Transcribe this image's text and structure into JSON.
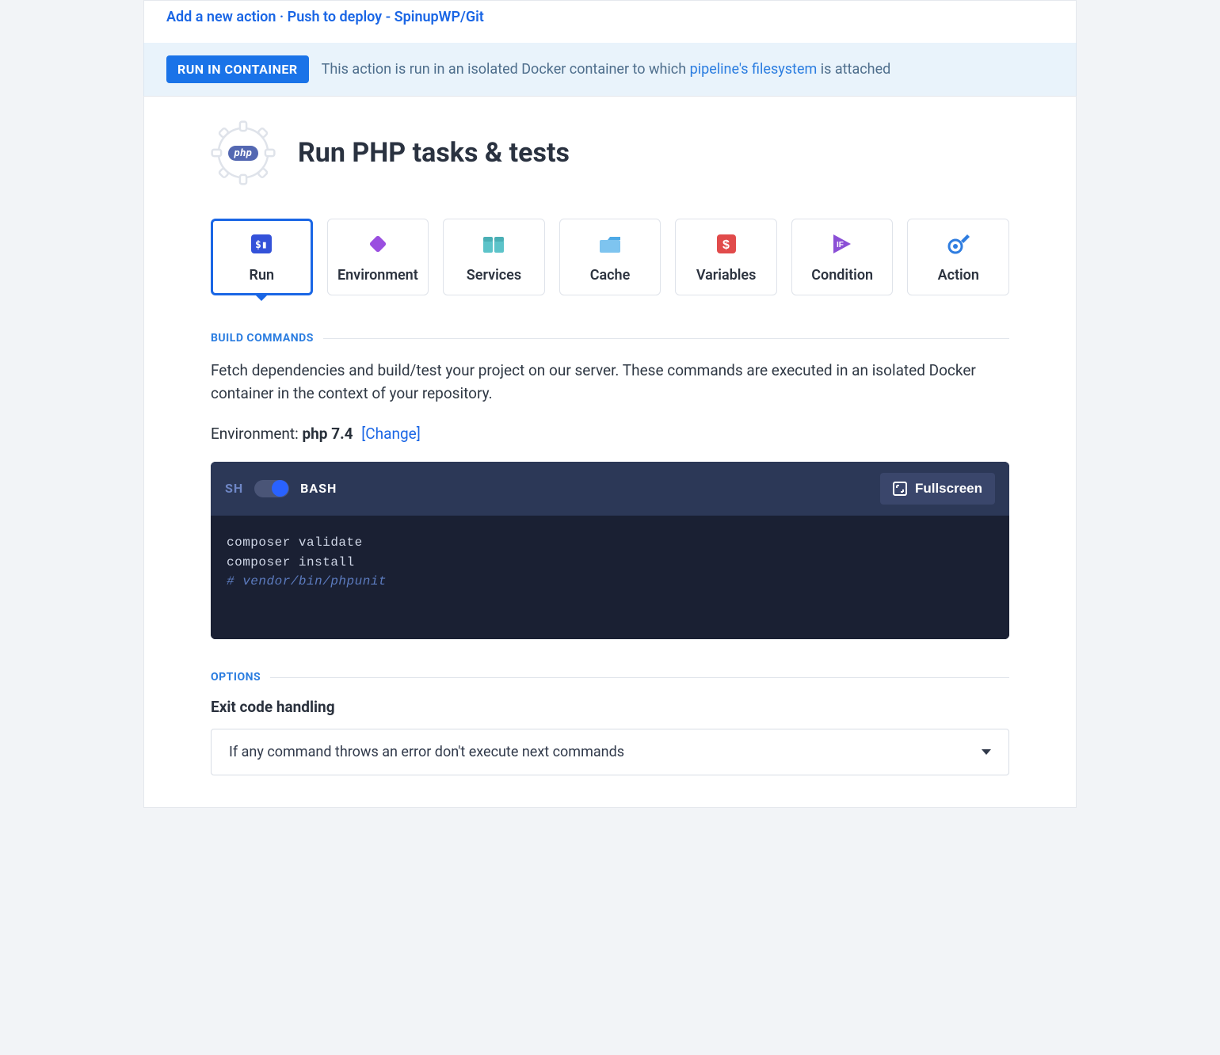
{
  "breadcrumb": {
    "a": "Add a new action",
    "b": "Push to deploy - SpinupWP/Git"
  },
  "infostrip": {
    "badge": "RUN IN CONTAINER",
    "text_a": "This action is run in an isolated Docker container to which ",
    "link": "pipeline's filesystem",
    "text_b": " is attached"
  },
  "header": {
    "title": "Run PHP tasks & tests",
    "badge_text": "php"
  },
  "tabs": [
    {
      "label": "Run"
    },
    {
      "label": "Environment"
    },
    {
      "label": "Services"
    },
    {
      "label": "Cache"
    },
    {
      "label": "Variables"
    },
    {
      "label": "Condition"
    },
    {
      "label": "Action"
    }
  ],
  "build": {
    "section": "BUILD COMMANDS",
    "help": "Fetch dependencies and build/test your project on our server. These commands are executed in an isolated Docker container in the context of your repository.",
    "env_label": "Environment: ",
    "env_value": "php 7.4",
    "change_label": "[Change]"
  },
  "editor": {
    "sh": "SH",
    "bash": "BASH",
    "fullscreen": "Fullscreen",
    "line1": "composer validate",
    "line2": "composer install",
    "line3": "# vendor/bin/phpunit"
  },
  "options": {
    "section": "OPTIONS",
    "heading": "Exit code handling",
    "select_value": "If any command throws an error don't execute next commands"
  }
}
